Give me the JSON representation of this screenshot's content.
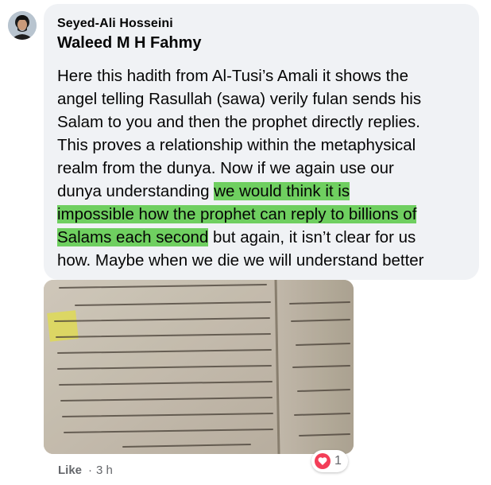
{
  "comment": {
    "author": "Seyed-Ali Hosseini",
    "mention": "Waleed M H Fahmy",
    "text": {
      "line1": "Here this hadith from Al-Tusi’s Amali it shows the",
      "line2": "angel telling Rasullah (sawa) verily fulan sends his",
      "line3": "Salam to you and then the prophet directly replies.",
      "line4": "This proves a relationship within the metaphysical",
      "line5": "realm from the dunya. Now if we again use our",
      "line6_plain": "dunya understanding ",
      "line6_highlight": "we would think it is",
      "line7_highlight": "impossible how the prophet can reply to billions of",
      "line8_highlight": "Salams each second",
      "line8_plain": " but again, it isn’t clear for us",
      "line9": "how. Maybe when we die we will understand better"
    },
    "highlight_color": "#6fcf60",
    "bubble_color": "#f0f2f5"
  },
  "attachment": {
    "icon": "photo-of-arabic-book-page"
  },
  "footer": {
    "like_label": "Like",
    "separator": "·",
    "timestamp": "3 h",
    "reaction_icon": "love-heart-icon",
    "reaction_count": "1"
  }
}
